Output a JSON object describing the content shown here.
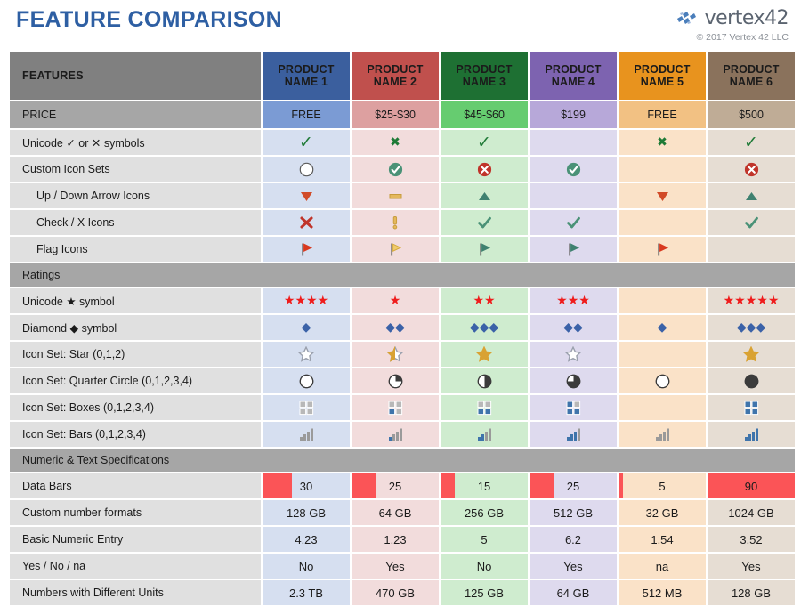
{
  "header": {
    "title": "FEATURE COMPARISON",
    "brand_name": "vertex42",
    "copyright": "© 2017 Vertex 42 LLC",
    "logo_icon": "vertex42-logo-icon"
  },
  "table": {
    "features_header": "FEATURES",
    "products": [
      {
        "name": "PRODUCT NAME 1",
        "line1": "PRODUCT",
        "line2": "NAME 1",
        "header_color": "#3b5f9e",
        "price_color": "#7b9bd4",
        "body_color": "#d6dff0",
        "price": "FREE"
      },
      {
        "name": "PRODUCT NAME 2",
        "line1": "PRODUCT",
        "line2": "NAME 2",
        "header_color": "#c0504d",
        "price_color": "#dda0a0",
        "body_color": "#f2dcdc",
        "price": "$25-$30"
      },
      {
        "name": "PRODUCT NAME 3",
        "line1": "PRODUCT",
        "line2": "NAME 3",
        "header_color": "#1e7033",
        "price_color": "#66cc70",
        "body_color": "#cfeccf",
        "price": "$45-$60"
      },
      {
        "name": "PRODUCT NAME 4",
        "line1": "PRODUCT",
        "line2": "NAME 4",
        "header_color": "#7d63b0",
        "price_color": "#b7a8d9",
        "body_color": "#dedaee",
        "price": "$199"
      },
      {
        "name": "PRODUCT NAME 5",
        "line1": "PRODUCT",
        "line2": "NAME 5",
        "header_color": "#e8931e",
        "price_color": "#f2c183",
        "body_color": "#fae2c8",
        "price": "FREE"
      },
      {
        "name": "PRODUCT NAME 6",
        "line1": "PRODUCT",
        "line2": "NAME 6",
        "header_color": "#8a725c",
        "price_color": "#bfac96",
        "body_color": "#e6ddd3",
        "price": "$500"
      }
    ],
    "price_row_label": "PRICE",
    "sections": [
      {
        "title": null,
        "rows": [
          {
            "label": "Unicode ✓ or ✕ symbols",
            "indent": false,
            "kind": "glyph",
            "values": [
              "check",
              "x",
              "check",
              "",
              "x",
              "check"
            ]
          },
          {
            "label": "Custom Icon Sets",
            "indent": false,
            "kind": "circle-icon",
            "values": [
              "empty",
              "green-check",
              "red-x",
              "green-check",
              "",
              "red-x"
            ]
          },
          {
            "label": "Up / Down Arrow Icons",
            "indent": true,
            "kind": "arrow-icon",
            "values": [
              "down",
              "flat",
              "up",
              "",
              "down",
              "up"
            ]
          },
          {
            "label": "Check / X Icons",
            "indent": true,
            "kind": "checkx-icon",
            "values": [
              "x",
              "excl",
              "check",
              "check",
              "",
              "check"
            ]
          },
          {
            "label": "Flag Icons",
            "indent": true,
            "kind": "flag-icon",
            "values": [
              "red",
              "yellow",
              "green",
              "green",
              "red",
              ""
            ]
          }
        ]
      },
      {
        "title": "Ratings",
        "rows": [
          {
            "label": "Unicode ★ symbol",
            "indent": false,
            "kind": "stars",
            "values": [
              4,
              1,
              2,
              3,
              0,
              5
            ]
          },
          {
            "label": "Diamond ◆ symbol",
            "indent": false,
            "kind": "diamonds",
            "values": [
              1,
              2,
              3,
              2,
              1,
              3
            ]
          },
          {
            "label": "Icon Set: Star (0,1,2)",
            "indent": false,
            "kind": "star-icon",
            "values": [
              0,
              1,
              2,
              0,
              null,
              2
            ]
          },
          {
            "label": "Icon Set: Quarter Circle (0,1,2,3,4)",
            "indent": false,
            "kind": "quarter-icon",
            "values": [
              0,
              1,
              2,
              3,
              0,
              4
            ]
          },
          {
            "label": "Icon Set: Boxes (0,1,2,3,4)",
            "indent": false,
            "kind": "boxes-icon",
            "values": [
              0,
              1,
              2,
              3,
              null,
              4
            ]
          },
          {
            "label": "Icon Set: Bars (0,1,2,3,4)",
            "indent": false,
            "kind": "bars-icon",
            "values": [
              0,
              1,
              2,
              3,
              0,
              4
            ]
          }
        ]
      },
      {
        "title": "Numeric & Text Specifications",
        "rows": [
          {
            "label": "Data Bars",
            "indent": false,
            "kind": "databar",
            "values": [
              30,
              25,
              15,
              25,
              5,
              90
            ],
            "max": 90
          },
          {
            "label": "Custom number formats",
            "indent": false,
            "kind": "text",
            "values": [
              "128 GB",
              "64 GB",
              "256 GB",
              "512 GB",
              "32 GB",
              "1024 GB"
            ]
          },
          {
            "label": "Basic Numeric Entry",
            "indent": false,
            "kind": "text",
            "values": [
              "4.23",
              "1.23",
              "5",
              "6.2",
              "1.54",
              "3.52"
            ]
          },
          {
            "label": "Yes / No / na",
            "indent": false,
            "kind": "text",
            "values": [
              "No",
              "Yes",
              "No",
              "Yes",
              "na",
              "Yes"
            ]
          },
          {
            "label": "Numbers with Different Units",
            "indent": false,
            "kind": "text",
            "values": [
              "2.3 TB",
              "470 GB",
              "125 GB",
              "64 GB",
              "512 MB",
              "128 GB"
            ]
          }
        ]
      }
    ]
  },
  "colors": {
    "title": "#2e5fa3",
    "header_gray": "#808080",
    "section_gray": "#a6a6a6",
    "row_label_gray": "#e0e0e0",
    "databar": "#fb5457",
    "unicode_green": "#1e7a36",
    "unicode_red": "#ef1c1c",
    "diamond_blue": "#3b62a8"
  }
}
